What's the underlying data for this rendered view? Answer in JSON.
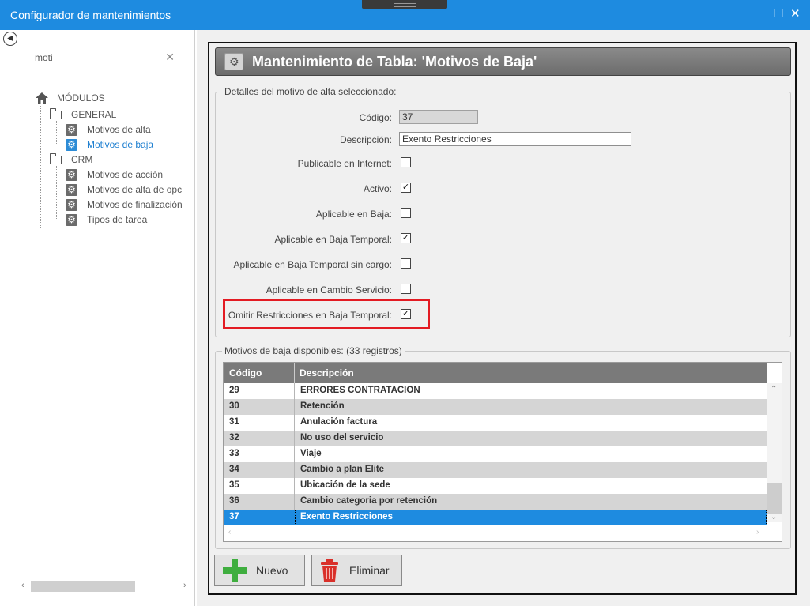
{
  "window": {
    "title": "Configurador de mantenimientos",
    "maximize_glyph": "☐",
    "close_glyph": "✕"
  },
  "sidebar": {
    "search_value": "moti",
    "search_clear_glyph": "✕",
    "tree": {
      "root_label": "MÓDULOS",
      "groups": [
        {
          "label": "GENERAL",
          "items": [
            "Motivos de alta",
            "Motivos de baja"
          ]
        },
        {
          "label": "CRM",
          "items": [
            "Motivos de acción",
            "Motivos de alta de opc",
            "Motivos de finalización",
            "Tipos de tarea"
          ]
        }
      ],
      "selected_item": "Motivos de baja"
    }
  },
  "main": {
    "header_title": "Mantenimiento de Tabla: 'Motivos de Baja'",
    "details": {
      "legend": "Detalles del motivo de alta seleccionado:",
      "codigo_label": "Código:",
      "codigo_value": "37",
      "descripcion_label": "Descripción:",
      "descripcion_value": "Exento Restricciones",
      "checks": [
        {
          "label": "Publicable en Internet:",
          "checked": false
        },
        {
          "label": "Activo:",
          "checked": true
        },
        {
          "label": "Aplicable en Baja:",
          "checked": false
        },
        {
          "label": "Aplicable en Baja Temporal:",
          "checked": true
        },
        {
          "label": "Aplicable en Baja Temporal sin cargo:",
          "checked": false
        },
        {
          "label": "Aplicable en Cambio Servicio:",
          "checked": false
        },
        {
          "label": "Omitir Restricciones en Baja Temporal:",
          "checked": true
        }
      ],
      "check_glyph": "✓"
    },
    "list": {
      "legend": "Motivos de baja disponibles:  (33 registros)",
      "columns": [
        "Código",
        "Descripción"
      ],
      "rows": [
        [
          "29",
          "ERRORES CONTRATACION"
        ],
        [
          "30",
          "Retención"
        ],
        [
          "31",
          "Anulación factura"
        ],
        [
          "32",
          "No uso del servicio"
        ],
        [
          "33",
          "Viaje"
        ],
        [
          "34",
          "Cambio a plan Elite"
        ],
        [
          "35",
          "Ubicación de la sede"
        ],
        [
          "36",
          "Cambio categoria por retención"
        ],
        [
          "37",
          "Exento Restricciones"
        ]
      ],
      "selected_code": "37"
    },
    "buttons": {
      "new_label": "Nuevo",
      "delete_label": "Eliminar"
    }
  },
  "colors": {
    "titlebar": "#1e8be0",
    "selection": "#1e8be0",
    "highlight_border": "#e31b23",
    "add_green": "#3fae3f",
    "delete_red": "#d9302a"
  }
}
